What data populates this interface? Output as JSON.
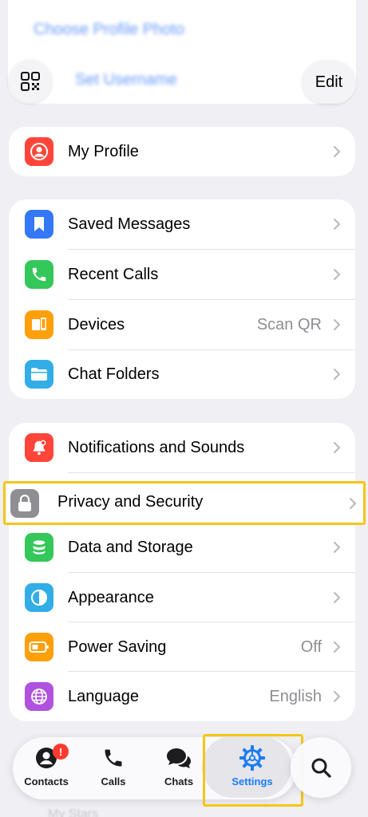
{
  "header": {
    "set_profile_photo": "Choose Profile Photo",
    "set_username": "Set Username",
    "edit_label": "Edit"
  },
  "profile_section": {
    "items": [
      {
        "label": "My Profile",
        "icon": "person-icon",
        "color": "#ff453a"
      }
    ]
  },
  "general_section": {
    "items": [
      {
        "label": "Saved Messages",
        "icon": "bookmark-icon",
        "color": "#3478f6"
      },
      {
        "label": "Recent Calls",
        "icon": "phone-icon",
        "color": "#34c759"
      },
      {
        "label": "Devices",
        "value": "Scan QR",
        "icon": "devices-icon",
        "color": "#ff9f0a"
      },
      {
        "label": "Chat Folders",
        "icon": "folder-icon",
        "color": "#32ade6"
      }
    ]
  },
  "settings_section": {
    "items": [
      {
        "label": "Notifications and Sounds",
        "icon": "bell-icon",
        "color": "#ff453a"
      },
      {
        "label": "Privacy and Security",
        "icon": "lock-icon",
        "color": "#8e8e93"
      },
      {
        "label": "Data and Storage",
        "icon": "database-icon",
        "color": "#34c759"
      },
      {
        "label": "Appearance",
        "icon": "half-circle-icon",
        "color": "#32ade6"
      },
      {
        "label": "Power Saving",
        "value": "Off",
        "icon": "battery-icon",
        "color": "#ff9f0a"
      },
      {
        "label": "Language",
        "value": "English",
        "icon": "globe-icon",
        "color": "#af52de"
      }
    ]
  },
  "tabbar": {
    "tabs": [
      {
        "label": "Contacts",
        "icon": "person-circle-icon",
        "badge": "!"
      },
      {
        "label": "Calls",
        "icon": "phone-icon"
      },
      {
        "label": "Chats",
        "icon": "chat-bubbles-icon"
      },
      {
        "label": "Settings",
        "icon": "gear-icon",
        "selected": true
      }
    ],
    "accent": "#1a7cf5",
    "highlight": "#f5c518"
  },
  "peek_text": "My Stars"
}
